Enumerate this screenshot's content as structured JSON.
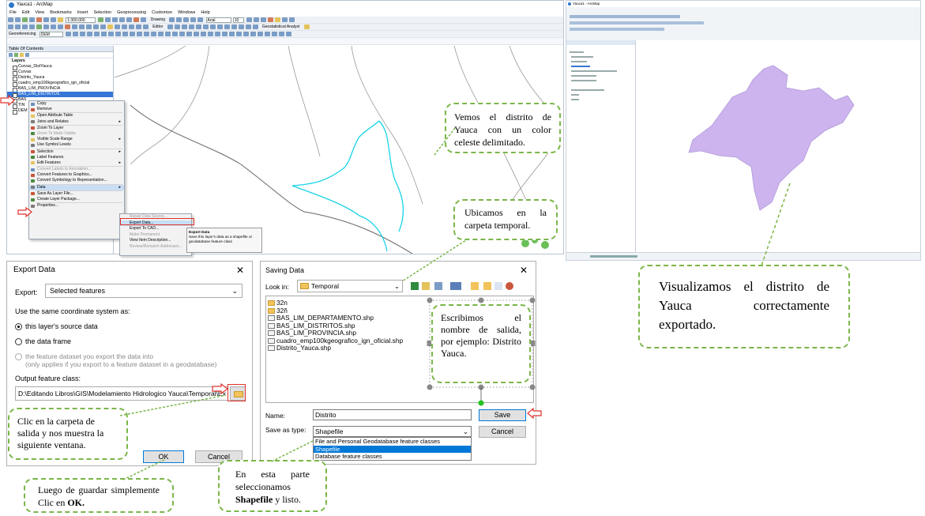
{
  "arcmap": {
    "title": "Yauca1 - ArcMap",
    "menus": [
      "File",
      "Edit",
      "View",
      "Bookmarks",
      "Insert",
      "Selection",
      "Geoprocessing",
      "Customize",
      "Windows",
      "Help"
    ],
    "scale": "1:300.000",
    "font_name": "Arial",
    "font_size": "10",
    "drawing_label": "Drawing",
    "editor_label": "Editor",
    "geostat_label": "Geostatistical Analyst",
    "georef_label": "Georeferencing",
    "georef_layer": "DEM",
    "toc_title": "Table Of Contents",
    "layers_label": "Layers",
    "toc_items": [
      "Curvas_DistYauca",
      "Curvas",
      "Distrito_Yauca",
      "cuadro_emp100kgeografico_ign_oficial",
      "BAS_LIM_PROVINCIA",
      "BAS_LIM_DISTRITOS",
      "BAS",
      "TIN",
      "DEM"
    ]
  },
  "context_menu": {
    "items": [
      {
        "label": "Copy",
        "disabled": false,
        "arrow": false
      },
      {
        "label": "Remove",
        "disabled": false,
        "arrow": false
      },
      {
        "sep": true
      },
      {
        "label": "Open Attribute Table",
        "disabled": false,
        "arrow": false
      },
      {
        "label": "Joins and Relates",
        "disabled": false,
        "arrow": true
      },
      {
        "sep": true
      },
      {
        "label": "Zoom To Layer",
        "disabled": false,
        "arrow": false
      },
      {
        "label": "Zoom To Make Visible",
        "disabled": true,
        "arrow": false
      },
      {
        "label": "Visible Scale Range",
        "disabled": false,
        "arrow": true
      },
      {
        "label": "Use Symbol Levels",
        "disabled": false,
        "arrow": false
      },
      {
        "sep": true
      },
      {
        "label": "Selection",
        "disabled": false,
        "arrow": true
      },
      {
        "label": "Label Features",
        "disabled": false,
        "arrow": false
      },
      {
        "label": "Edit Features",
        "disabled": false,
        "arrow": true
      },
      {
        "sep": true
      },
      {
        "label": "Convert Labels to Annotation...",
        "disabled": true,
        "arrow": false
      },
      {
        "label": "Convert Features to Graphics...",
        "disabled": false,
        "arrow": false
      },
      {
        "label": "Convert Symbology to Representation...",
        "disabled": false,
        "arrow": false
      },
      {
        "sep": true
      },
      {
        "label": "Data",
        "disabled": false,
        "arrow": true,
        "highlight": true
      },
      {
        "sep": true
      },
      {
        "label": "Save As Layer File...",
        "disabled": false,
        "arrow": false
      },
      {
        "label": "Create Layer Package...",
        "disabled": false,
        "arrow": false
      },
      {
        "sep": true
      },
      {
        "label": "Properties...",
        "disabled": false,
        "arrow": false
      }
    ]
  },
  "submenu": {
    "items": [
      {
        "label": "Repair Data Source...",
        "disabled": true
      },
      {
        "label": "Export Data...",
        "disabled": false,
        "highlight": true
      },
      {
        "label": "Export To CAD...",
        "disabled": false
      },
      {
        "label": "Make Permanent",
        "disabled": true
      },
      {
        "label": "View Item Description...",
        "disabled": false
      },
      {
        "label": "Review/Rematch Addresses...",
        "disabled": true
      }
    ]
  },
  "tooltip": {
    "title": "Export Data",
    "body": "Save this layer's data as a shapefile or geodatabase feature class"
  },
  "export_dialog": {
    "title": "Export Data",
    "export_label": "Export:",
    "export_value": "Selected features",
    "coord_label": "Use the same coordinate system as:",
    "opt1": "this layer's source data",
    "opt2": "the data frame",
    "opt3_line1": "the feature dataset you export the data into",
    "opt3_line2": "(only applies if you export to a feature dataset in a geodatabase)",
    "output_label": "Output feature class:",
    "output_path": "D:\\Editando Libros\\GIS\\Modelamiento Hidrologico Yauca\\Temporal\\Ex",
    "ok": "OK",
    "cancel": "Cancel"
  },
  "save_dialog": {
    "title": "Saving Data",
    "look_in_label": "Look in:",
    "look_in_value": "Temporal",
    "files": [
      {
        "name": "32n",
        "folder": true
      },
      {
        "name": "32ñ",
        "folder": true
      },
      {
        "name": "BAS_LIM_DEPARTAMENTO.shp",
        "folder": false
      },
      {
        "name": "BAS_LIM_DISTRITOS.shp",
        "folder": false
      },
      {
        "name": "BAS_LIM_PROVINCIA.shp",
        "folder": false
      },
      {
        "name": "cuadro_emp100kgeografico_ign_oficial.shp",
        "folder": false
      },
      {
        "name": "Distrito_Yauca.shp",
        "folder": false
      }
    ],
    "name_label": "Name:",
    "name_value": "Distrito",
    "type_label": "Save as type:",
    "type_value": "Shapefile",
    "type_options": [
      "File and Personal Geodatabase feature classes",
      "Shapefile",
      "Database feature classes"
    ],
    "save": "Save",
    "cancel": "Cancel"
  },
  "callouts": {
    "c1": "Vemos el distrito de Yauca con un color celeste delimitado.",
    "c2": "Ubicamos en la carpeta temporal.",
    "c3": "Escribimos el nombre de salida, por ejemplo: Distrito Yauca.",
    "c4": "Clic en la carpeta de salida y nos muestra la siguiente ventana.",
    "c5_pre": "Luego de guardar simplemente Clic en ",
    "c5_bold": "OK.",
    "c6_pre": "En esta parte seleccionamos ",
    "c6_bold": "Shapefile",
    "c6_post": " y listo.",
    "c7": "Visualizamos el distrito de Yauca correctamente exportado."
  },
  "colors": {
    "callout_border": "#7ab648",
    "red_marker": "#e0322a",
    "district_outline": "#19d3e8",
    "district_fill": "#cdb4ee",
    "selection_blue": "#3576d6"
  }
}
